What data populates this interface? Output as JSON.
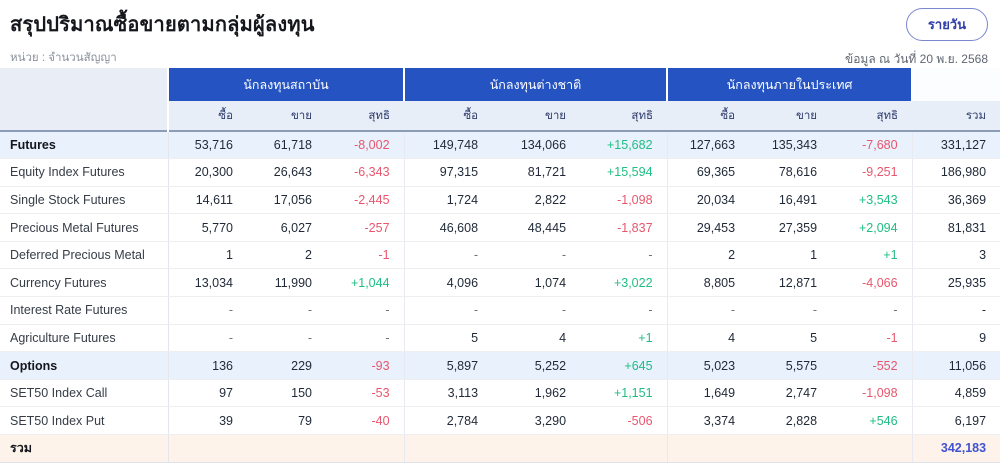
{
  "page": {
    "title": "สรุปปริมาณซื้อขายตามกลุ่มผู้ลงทุน",
    "unit_label": "หน่วย : จำนวนสัญญา",
    "as_of_label": "ข้อมูล ณ วันที่ 20 พ.ย. 2568",
    "period_button": "รายวัน"
  },
  "colors": {
    "header_blue": "#2553c1",
    "subheader_bg": "#e8eef8",
    "section_row_bg": "#e9f1fc",
    "total_row_bg": "#fdf3ea",
    "negative": "#e8566d",
    "positive": "#1fbe83",
    "grand_total_text": "#4153d0"
  },
  "table": {
    "groups": [
      {
        "label": "นักลงทุนสถาบัน"
      },
      {
        "label": "นักลงทุนต่างชาติ"
      },
      {
        "label": "นักลงทุนภายในประเทศ"
      }
    ],
    "sub_columns": [
      "ซื้อ",
      "ขาย",
      "สุทธิ"
    ],
    "total_column": "รวม",
    "rows": [
      {
        "label": "Futures",
        "kind": "section",
        "cells": [
          "53,716",
          "61,718",
          "-8,002",
          "149,748",
          "134,066",
          "+15,682",
          "127,663",
          "135,343",
          "-7,680"
        ],
        "total": "331,127"
      },
      {
        "label": "Equity Index Futures",
        "kind": "item",
        "cells": [
          "20,300",
          "26,643",
          "-6,343",
          "97,315",
          "81,721",
          "+15,594",
          "69,365",
          "78,616",
          "-9,251"
        ],
        "total": "186,980"
      },
      {
        "label": "Single Stock Futures",
        "kind": "item",
        "cells": [
          "14,611",
          "17,056",
          "-2,445",
          "1,724",
          "2,822",
          "-1,098",
          "20,034",
          "16,491",
          "+3,543"
        ],
        "total": "36,369"
      },
      {
        "label": "Precious Metal Futures",
        "kind": "item",
        "cells": [
          "5,770",
          "6,027",
          "-257",
          "46,608",
          "48,445",
          "-1,837",
          "29,453",
          "27,359",
          "+2,094"
        ],
        "total": "81,831"
      },
      {
        "label": "Deferred Precious Metal",
        "kind": "item",
        "cells": [
          "1",
          "2",
          "-1",
          "-",
          "-",
          "-",
          "2",
          "1",
          "+1"
        ],
        "total": "3"
      },
      {
        "label": "Currency Futures",
        "kind": "item",
        "cells": [
          "13,034",
          "11,990",
          "+1,044",
          "4,096",
          "1,074",
          "+3,022",
          "8,805",
          "12,871",
          "-4,066"
        ],
        "total": "25,935"
      },
      {
        "label": "Interest Rate Futures",
        "kind": "item",
        "cells": [
          "-",
          "-",
          "-",
          "-",
          "-",
          "-",
          "-",
          "-",
          "-"
        ],
        "total": "-"
      },
      {
        "label": "Agriculture Futures",
        "kind": "item",
        "cells": [
          "-",
          "-",
          "-",
          "5",
          "4",
          "+1",
          "4",
          "5",
          "-1"
        ],
        "total": "9"
      },
      {
        "label": "Options",
        "kind": "section",
        "cells": [
          "136",
          "229",
          "-93",
          "5,897",
          "5,252",
          "+645",
          "5,023",
          "5,575",
          "-552"
        ],
        "total": "11,056"
      },
      {
        "label": "SET50 Index Call",
        "kind": "item",
        "cells": [
          "97",
          "150",
          "-53",
          "3,113",
          "1,962",
          "+1,151",
          "1,649",
          "2,747",
          "-1,098"
        ],
        "total": "4,859"
      },
      {
        "label": "SET50 Index Put",
        "kind": "item",
        "cells": [
          "39",
          "79",
          "-40",
          "2,784",
          "3,290",
          "-506",
          "3,374",
          "2,828",
          "+546"
        ],
        "total": "6,197"
      },
      {
        "label": "รวม",
        "kind": "total",
        "cells": [
          "",
          "",
          "",
          "",
          "",
          "",
          "",
          "",
          ""
        ],
        "total": "342,183"
      }
    ]
  }
}
